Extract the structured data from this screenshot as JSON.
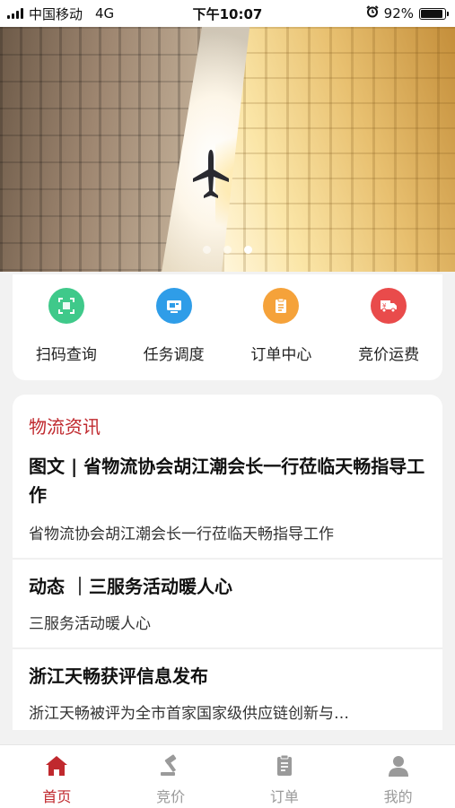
{
  "status_bar": {
    "carrier": "中国移动",
    "network": "4G",
    "time": "下午10:07",
    "battery": "92%",
    "battery_level": 0.92
  },
  "banner": {
    "slide_count": 3,
    "active_slide": 3
  },
  "quick_actions": [
    {
      "label": "扫码查询",
      "icon": "scan-icon",
      "color": "#3fc98a"
    },
    {
      "label": "任务调度",
      "icon": "dispatch-icon",
      "color": "#2f9de8"
    },
    {
      "label": "订单中心",
      "icon": "clipboard-icon",
      "color": "#f5a23a"
    },
    {
      "label": "竞价运费",
      "icon": "truck-icon",
      "color": "#e94b4b"
    }
  ],
  "news": {
    "title": "物流资讯",
    "items": [
      {
        "headline": "图文 | 省物流协会胡江潮会长一行莅临天畅指导工作",
        "summary": "省物流协会胡江潮会长一行莅临天畅指导工作"
      },
      {
        "headline": "动态 ｜三服务活动暖人心",
        "summary": "三服务活动暖人心"
      },
      {
        "headline": "浙江天畅获评信息发布",
        "summary": "浙江天畅被评为全市首家国家级供应链创新与…"
      }
    ]
  },
  "tabbar": {
    "items": [
      {
        "label": "首页",
        "icon": "home-icon",
        "active": true
      },
      {
        "label": "竞价",
        "icon": "gavel-icon",
        "active": false
      },
      {
        "label": "订单",
        "icon": "order-icon",
        "active": false
      },
      {
        "label": "我的",
        "icon": "user-icon",
        "active": false
      }
    ]
  },
  "colors": {
    "accent": "#c0292e",
    "inactive_tab": "#9a9a9a"
  }
}
